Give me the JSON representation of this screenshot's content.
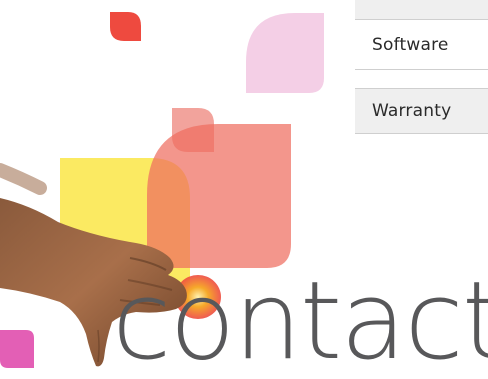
{
  "menu": {
    "items": [
      {
        "label": ""
      },
      {
        "label": "Software"
      },
      {
        "label": "Warranty"
      }
    ]
  },
  "hero": {
    "heading": "contact"
  },
  "colors": {
    "heading": "#58585a",
    "menu_text": "#2a2a2a",
    "menu_bg": "#efefef",
    "menu_border": "#cfcfcf",
    "leaf_red": "#ee4a3f",
    "leaf_pink": "#f4cfe6",
    "leaf_salmon": "#f28c84",
    "leaf_yellow": "#fbe95a",
    "leaf_magenta": "#e35fb5",
    "glow_orange": "#f6a92a"
  },
  "icons": {
    "decoration": "leaf-shape",
    "image": "thumbs-down-hand"
  }
}
